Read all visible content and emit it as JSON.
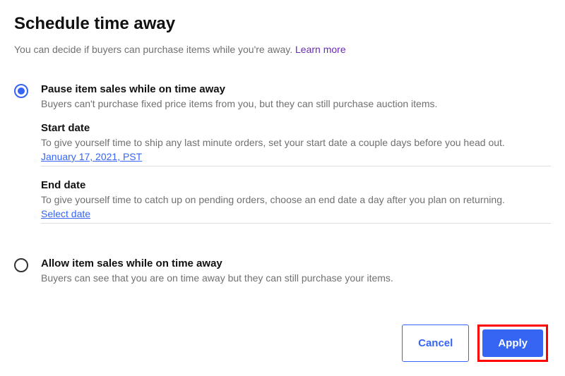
{
  "header": {
    "title": "Schedule time away",
    "subtitle": "You can decide if buyers can purchase items while you're away. ",
    "learn_more": "Learn more"
  },
  "options": {
    "pause": {
      "title": "Pause item sales while on time away",
      "desc": "Buyers can't purchase fixed price items from you, but they can still purchase auction items.",
      "start_date": {
        "label": "Start date",
        "desc": "To give yourself time to ship any last minute orders, set your start date a couple days before you head out.",
        "link": "January 17, 2021, PST"
      },
      "end_date": {
        "label": "End date",
        "desc": "To give yourself time to catch up on pending orders, choose an end date a day after you plan on returning.",
        "link": "Select date"
      }
    },
    "allow": {
      "title": "Allow item sales while on time away",
      "desc": "Buyers can see that you are on time away but they can still purchase your items."
    }
  },
  "buttons": {
    "cancel": "Cancel",
    "apply": "Apply"
  }
}
